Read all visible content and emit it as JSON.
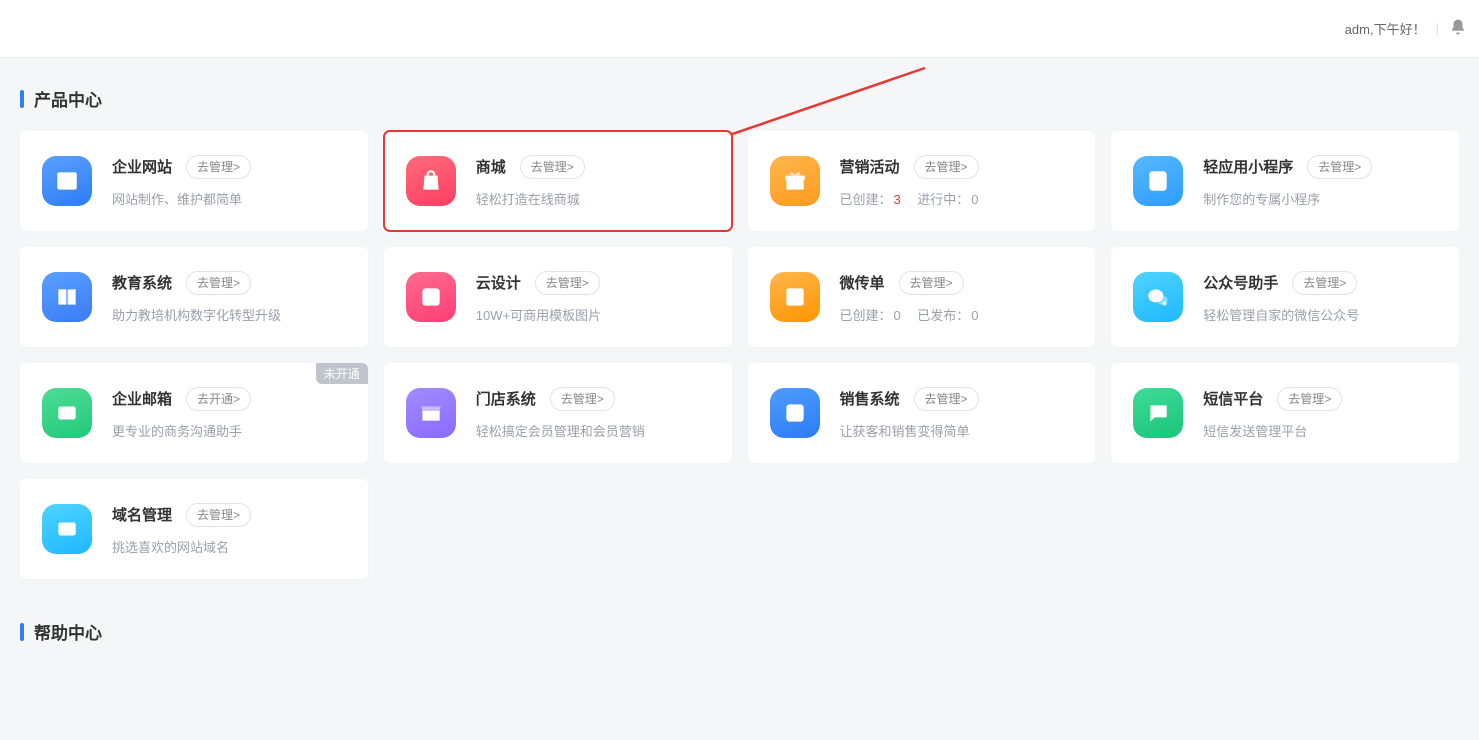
{
  "header": {
    "greeting": "adm,下午好！"
  },
  "sections": {
    "products": "产品中心",
    "help": "帮助中心"
  },
  "btn": {
    "manage": "去管理>",
    "open": "去开通>"
  },
  "tags": {
    "unopen": "未开通"
  },
  "cards": [
    {
      "title": "企业网站",
      "desc_plain": "网站制作、维护都简单"
    },
    {
      "title": "商城",
      "desc_plain": "轻松打造在线商城"
    },
    {
      "title": "营销活动",
      "stats": {
        "l1": "已创建：",
        "v1": "3",
        "l2": "进行中：",
        "v2": "0"
      }
    },
    {
      "title": "轻应用小程序",
      "desc_plain": "制作您的专属小程序"
    },
    {
      "title": "教育系统",
      "desc_plain": "助力教培机构数字化转型升级"
    },
    {
      "title": "云设计",
      "desc_plain": "10W+可商用模板图片"
    },
    {
      "title": "微传单",
      "stats": {
        "l1": "已创建：",
        "v1": "0",
        "l2": "已发布：",
        "v2": "0"
      }
    },
    {
      "title": "公众号助手",
      "desc_plain": "轻松管理自家的微信公众号"
    },
    {
      "title": "企业邮箱",
      "desc_plain": "更专业的商务沟通助手"
    },
    {
      "title": "门店系统",
      "desc_plain": "轻松搞定会员管理和会员营销"
    },
    {
      "title": "销售系统",
      "desc_plain": "让获客和销售变得简单"
    },
    {
      "title": "短信平台",
      "desc_plain": "短信发送管理平台"
    },
    {
      "title": "域名管理",
      "desc_plain": "挑选喜欢的网站域名"
    }
  ]
}
